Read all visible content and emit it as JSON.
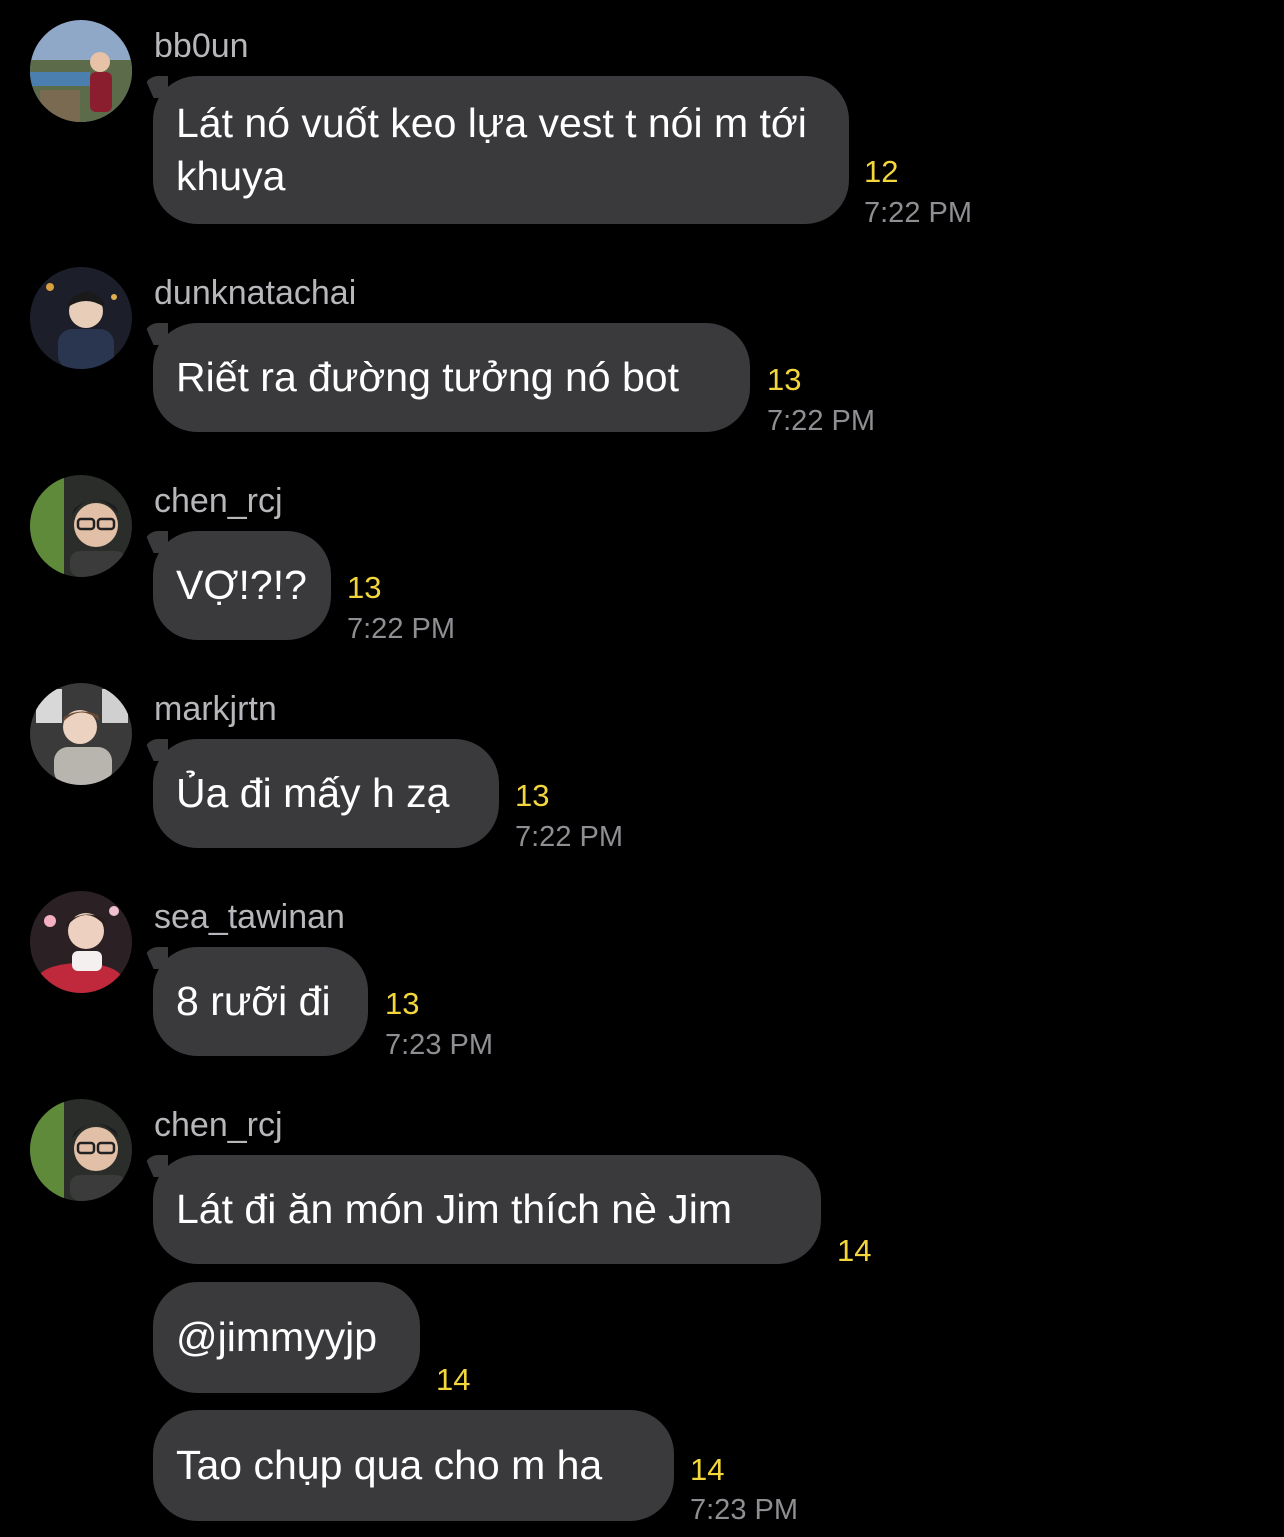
{
  "colors": {
    "background": "#000000",
    "bubble": "#3a3a3c",
    "sender": "#b7b7bb",
    "message_text": "#ffffff",
    "read_count": "#f2d63c",
    "timestamp": "#8e8e93"
  },
  "messages": [
    {
      "sender": "bb0un",
      "avatar": "avatar-photo",
      "bubbles": [
        {
          "text": "Lát nó vuốt keo lựa vest t nói m tới khuya",
          "count": "12",
          "time": "7:22 PM"
        }
      ]
    },
    {
      "sender": "dunknatachai",
      "avatar": "avatar-photo",
      "bubbles": [
        {
          "text": "Riết ra đường tưởng nó bot",
          "count": "13",
          "time": "7:22 PM"
        }
      ]
    },
    {
      "sender": "chen_rcj",
      "avatar": "avatar-photo",
      "bubbles": [
        {
          "text": "VỢ!?!?",
          "count": "13",
          "time": "7:22 PM"
        }
      ]
    },
    {
      "sender": "markjrtn",
      "avatar": "avatar-photo",
      "bubbles": [
        {
          "text": "Ủa đi mấy h zạ",
          "count": "13",
          "time": "7:22 PM"
        }
      ]
    },
    {
      "sender": "sea_tawinan",
      "avatar": "avatar-photo",
      "bubbles": [
        {
          "text": "8 rưỡi đi",
          "count": "13",
          "time": "7:23 PM"
        }
      ]
    },
    {
      "sender": "chen_rcj",
      "avatar": "avatar-photo",
      "bubbles": [
        {
          "text": "Lát đi ăn món Jim thích nè Jim",
          "count": "14"
        },
        {
          "text": "@jimmyyjp",
          "count": "14"
        },
        {
          "text": "Tao chụp qua cho m ha",
          "count": "14",
          "time": "7:23 PM"
        }
      ]
    }
  ]
}
